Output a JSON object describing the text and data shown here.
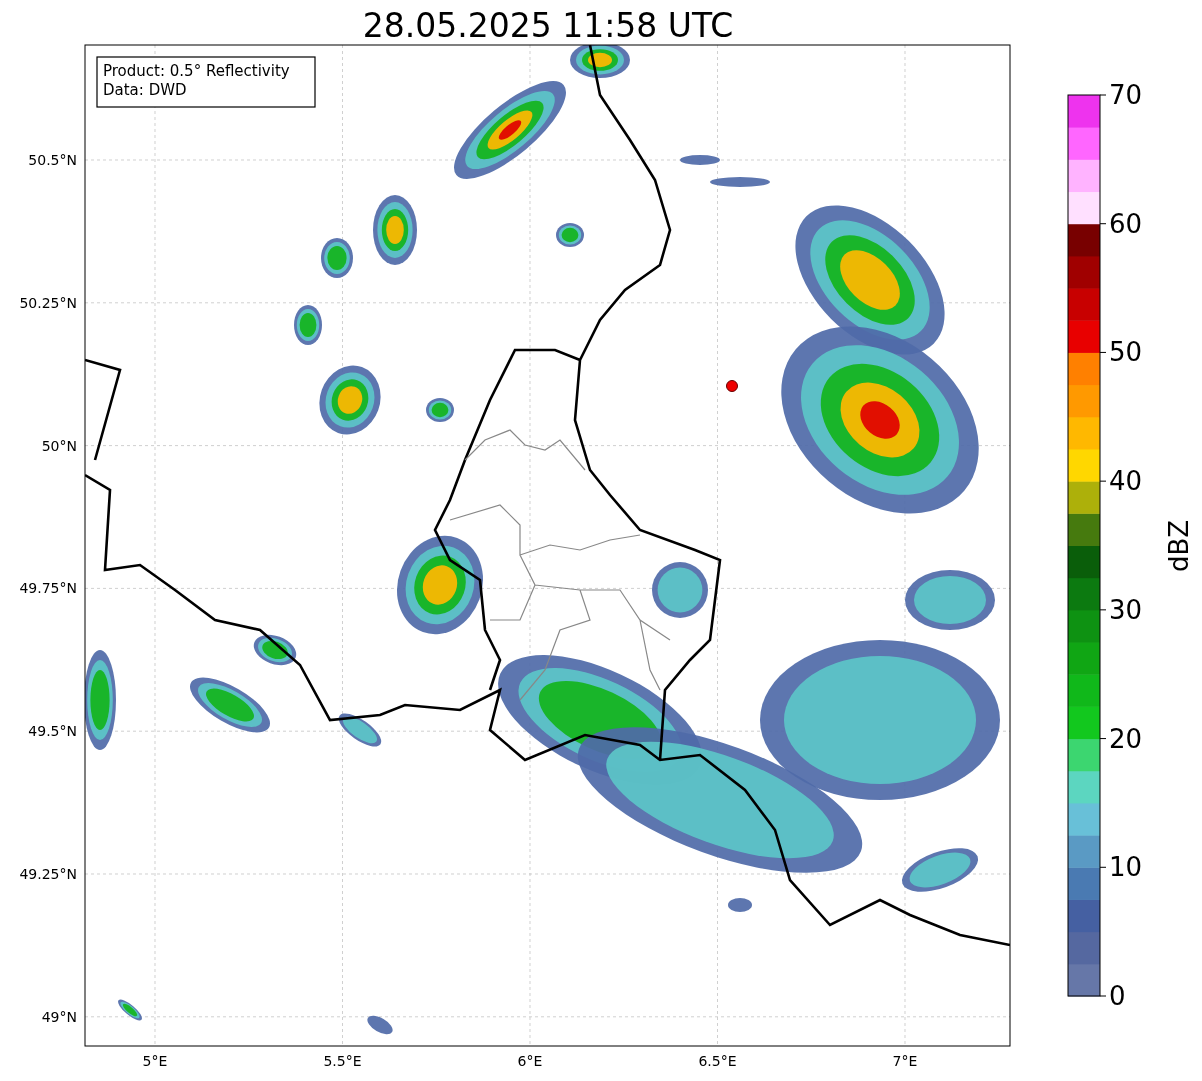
{
  "title": "28.05.2025 11:58 UTC",
  "legend": [
    "Product: 0.5° Reflectivity",
    "Data: DWD"
  ],
  "map": {
    "y_ticks": [
      "50.5°N",
      "50.25°N",
      "50°N",
      "49.75°N",
      "49.5°N",
      "49.25°N",
      "49°N"
    ],
    "x_ticks": [
      "5°E",
      "5.5°E",
      "6°E",
      "6.5°E",
      "7°E"
    ]
  },
  "colorbar": {
    "label": "dBZ",
    "ticks": [
      "70",
      "60",
      "50",
      "40",
      "30",
      "20",
      "10",
      "0"
    ],
    "segments": [
      {
        "color": "#6677a8"
      },
      {
        "color": "#5568a0"
      },
      {
        "color": "#4560a2"
      },
      {
        "color": "#4a7ab2"
      },
      {
        "color": "#5a9ac4"
      },
      {
        "color": "#68c0d8"
      },
      {
        "color": "#5cd6c0"
      },
      {
        "color": "#3cd670"
      },
      {
        "color": "#12c81e"
      },
      {
        "color": "#10b81a"
      },
      {
        "color": "#10a614"
      },
      {
        "color": "#0e9212"
      },
      {
        "color": "#0c7a10"
      },
      {
        "color": "#0a5e0a"
      },
      {
        "color": "#467a0e"
      },
      {
        "color": "#adb00a"
      },
      {
        "color": "#ffd700"
      },
      {
        "color": "#ffb800"
      },
      {
        "color": "#ff9900"
      },
      {
        "color": "#ff8000"
      },
      {
        "color": "#e80000"
      },
      {
        "color": "#c80000"
      },
      {
        "color": "#a00000"
      },
      {
        "color": "#780000"
      },
      {
        "color": "#ffe0ff"
      },
      {
        "color": "#ffb3ff"
      },
      {
        "color": "#ff66ff"
      },
      {
        "color": "#ee33ee"
      }
    ]
  }
}
